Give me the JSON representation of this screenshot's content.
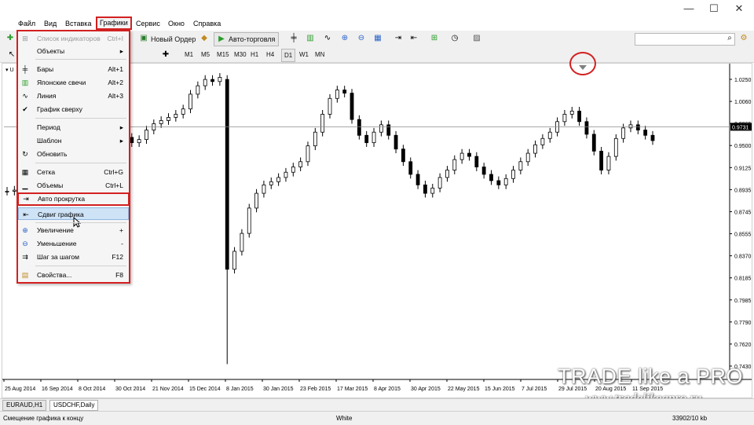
{
  "window": {
    "minimize": "—",
    "maximize": "☐",
    "close": "✕"
  },
  "menubar": [
    "Файл",
    "Вид",
    "Вставка",
    "Графики",
    "Сервис",
    "Окно",
    "Справка"
  ],
  "menubar_active": "Графики",
  "toolbar": {
    "new_order": "Новый Ордер",
    "auto_trading": "Авто-торговля",
    "timeframes": [
      "M1",
      "M5",
      "M15",
      "M30",
      "H1",
      "H4",
      "D1",
      "W1",
      "MN"
    ],
    "search_placeholder": ""
  },
  "dropdown": {
    "items": [
      {
        "label": "Список индикаторов",
        "shortcut": "Ctrl+I",
        "disabled": true,
        "icon": "indicators-icon"
      },
      {
        "label": "Объекты",
        "shortcut": "▸",
        "icon": ""
      },
      {
        "label": "Бары",
        "shortcut": "Alt+1",
        "icon": "bars-icon"
      },
      {
        "label": "Японские свечи",
        "shortcut": "Alt+2",
        "icon": "candles-icon"
      },
      {
        "label": "Линия",
        "shortcut": "Alt+3",
        "icon": "line-chart-icon"
      },
      {
        "label": "График сверху",
        "shortcut": "",
        "icon": "check-icon"
      },
      {
        "label": "Период",
        "shortcut": "▸",
        "icon": ""
      },
      {
        "label": "Шаблон",
        "shortcut": "▸",
        "icon": ""
      },
      {
        "label": "Обновить",
        "shortcut": "",
        "icon": "refresh-icon"
      },
      {
        "label": "Сетка",
        "shortcut": "Ctrl+G",
        "icon": "grid-icon"
      },
      {
        "label": "Объемы",
        "shortcut": "Ctrl+L",
        "icon": "volumes-icon"
      },
      {
        "label": "Авто прокрутка",
        "shortcut": "",
        "icon": "auto-scroll-icon"
      },
      {
        "label": "Сдвиг графика",
        "shortcut": "",
        "icon": "chart-shift-icon"
      },
      {
        "label": "Увеличение",
        "shortcut": "+",
        "icon": "zoom-in-icon"
      },
      {
        "label": "Уменьшение",
        "shortcut": "-",
        "icon": "zoom-out-icon"
      },
      {
        "label": "Шаг за шагом",
        "shortcut": "F12",
        "icon": "step-icon"
      },
      {
        "label": "Свойства...",
        "shortcut": "F8",
        "icon": "properties-icon"
      }
    ]
  },
  "chart_data": {
    "type": "candlestick",
    "symbol_label": "U",
    "current_price": "0.9731",
    "y_ticks": [
      "1.0250",
      "1.0060",
      "0.9865",
      "0.9500",
      "0.9125",
      "0.8935",
      "0.8745",
      "0.8555",
      "0.8370",
      "0.8185",
      "0.7985",
      "0.7790",
      "0.7620",
      "0.7430"
    ],
    "x_ticks": [
      "25 Aug 2014",
      "16 Sep 2014",
      "8 Oct 2014",
      "30 Oct 2014",
      "21 Nov 2014",
      "15 Dec 2014",
      "8 Jan 2015",
      "30 Jan 2015",
      "23 Feb 2015",
      "17 Mar 2015",
      "8 Apr 2015",
      "30 Apr 2015",
      "22 May 2015",
      "15 Jun 2015",
      "7 Jul 2015",
      "29 Jul 2015",
      "20 Aug 2015",
      "11 Sep 2015"
    ],
    "ylim": [
      0.735,
      1.03
    ],
    "closes": [
      0.912,
      0.913,
      0.911,
      0.912,
      0.958,
      0.962,
      0.966,
      0.96,
      0.963,
      0.967,
      0.962,
      0.968,
      0.966,
      0.972,
      0.971,
      0.967,
      0.963,
      0.958,
      0.961,
      0.97,
      0.976,
      0.979,
      0.982,
      0.985,
      0.99,
      1.004,
      1.012,
      1.018,
      1.016,
      1.02,
      0.838,
      0.855,
      0.872,
      0.896,
      0.91,
      0.918,
      0.921,
      0.925,
      0.93,
      0.935,
      0.94,
      0.955,
      0.968,
      0.985,
      1.0,
      1.008,
      1.005,
      0.98,
      0.965,
      0.958,
      0.968,
      0.975,
      0.965,
      0.952,
      0.94,
      0.928,
      0.918,
      0.91,
      0.915,
      0.925,
      0.932,
      0.942,
      0.948,
      0.945,
      0.935,
      0.928,
      0.922,
      0.918,
      0.924,
      0.932,
      0.94,
      0.948,
      0.956,
      0.962,
      0.968,
      0.978,
      0.985,
      0.988,
      0.978,
      0.966,
      0.95,
      0.932,
      0.945,
      0.962,
      0.972,
      0.975,
      0.97,
      0.965,
      0.96
    ]
  },
  "tabs": [
    "EURAUD,H1",
    "USDCHF,Daily"
  ],
  "status": {
    "hint": "Смещение графика к концу",
    "profile": "White",
    "traffic": "33902/10 kb"
  },
  "watermark": {
    "brand": "TRADE like a PRO",
    "site": "www.tradelikeapro.ru"
  }
}
